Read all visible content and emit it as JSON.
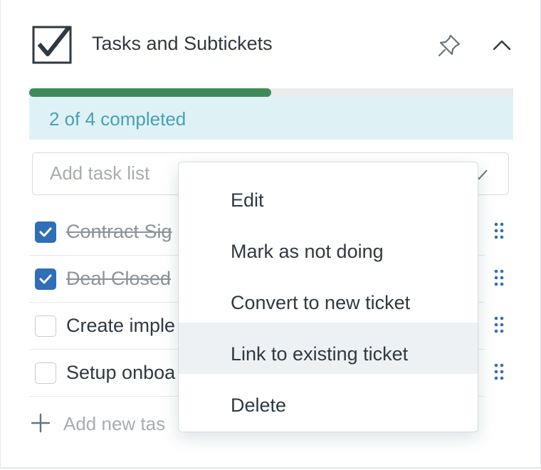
{
  "header": {
    "title": "Tasks and Subtickets",
    "icon": "checkbox-icon",
    "pin_icon": "pin-icon",
    "collapse_icon": "chevron-up-icon"
  },
  "progress": {
    "fraction": 0.5,
    "text": "2 of 4 completed",
    "colors": {
      "fill": "#3d8b5a",
      "banner": "#def2f6",
      "text": "#4a9fb3"
    }
  },
  "add_task_list": {
    "placeholder": "Add task list",
    "confirm_icon": "checkmark-icon"
  },
  "tasks": [
    {
      "label": "Contract Sig",
      "done": true
    },
    {
      "label": "Deal Closed",
      "done": true
    },
    {
      "label": "Create imple",
      "done": false
    },
    {
      "label": "Setup onboa",
      "done": false
    }
  ],
  "add_task": {
    "label": "Add new tas",
    "icon": "plus-icon"
  },
  "context_menu": {
    "items": [
      {
        "label": "Edit"
      },
      {
        "label": "Mark as not doing"
      },
      {
        "label": "Convert to new ticket"
      },
      {
        "label": "Link to existing ticket",
        "highlighted": true
      },
      {
        "label": "Delete"
      }
    ]
  },
  "colors": {
    "accent": "#2f6eb8",
    "text": "#2f3941",
    "muted": "#a7adb2"
  }
}
